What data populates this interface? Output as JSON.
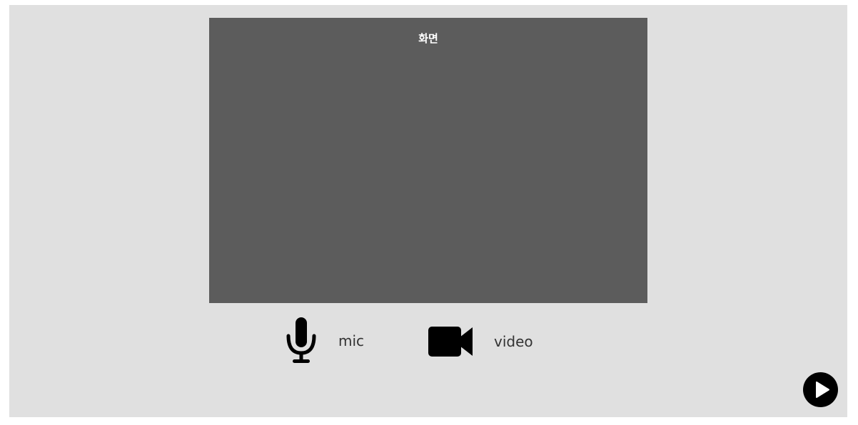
{
  "screen": {
    "label": "화면"
  },
  "controls": {
    "mic": {
      "label": "mic",
      "icon": "microphone-icon"
    },
    "video": {
      "label": "video",
      "icon": "video-camera-icon"
    }
  },
  "next_button": {
    "icon": "play-icon"
  },
  "colors": {
    "page_bg": "#ffffff",
    "panel_bg": "#e0e0e0",
    "screen_bg": "#5c5c5c",
    "icon": "#000000"
  }
}
